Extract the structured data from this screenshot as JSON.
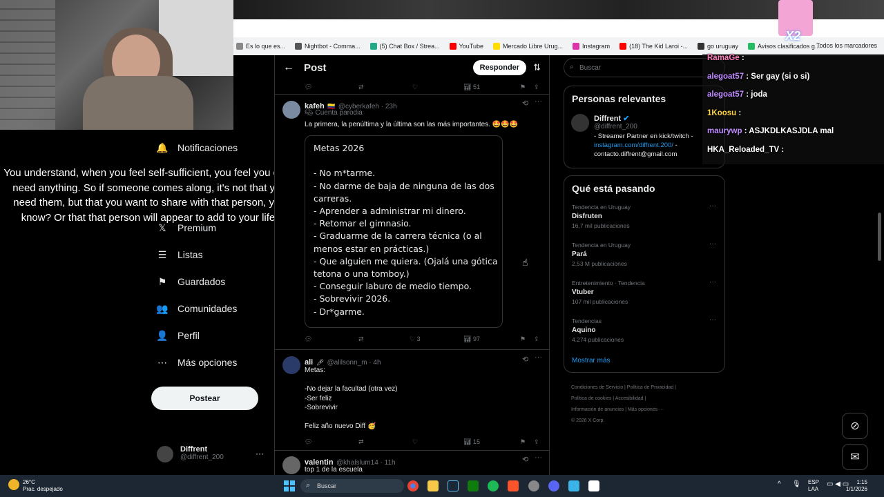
{
  "subtitle": "You understand, when you feel self-sufficient, you feel you don't need anything. So if someone comes along, it's not that you need them, but that you want to share with that person, you know? Or that that person will appear to add to your life.",
  "bookmarks": [
    {
      "label": "Es lo que es...",
      "color": "#888"
    },
    {
      "label": "Nightbot - Comma...",
      "color": "#555"
    },
    {
      "label": "(5) Chat Box / Strea...",
      "color": "#2a8"
    },
    {
      "label": "YouTube",
      "color": "#f00"
    },
    {
      "label": "Mercado Libre Urug...",
      "color": "#fd0"
    },
    {
      "label": "Instagram",
      "color": "#d3a"
    },
    {
      "label": "(18) The Kid Laroi -...",
      "color": "#f00"
    },
    {
      "label": "go uruguay",
      "color": "#333"
    },
    {
      "label": "Avisos clasificados g...",
      "color": "#2b6"
    }
  ],
  "bookmarks_right": "Todos los marcadores",
  "nav": [
    {
      "label": "Notificaciones",
      "icon": "bell-icon",
      "glyph": "🔔"
    },
    {
      "label": "Premium",
      "icon": "x-logo-icon",
      "glyph": "𝕏"
    },
    {
      "label": "Listas",
      "icon": "list-icon",
      "glyph": "☰"
    },
    {
      "label": "Guardados",
      "icon": "bookmark-icon",
      "glyph": "⚑"
    },
    {
      "label": "Comunidades",
      "icon": "communities-icon",
      "glyph": "👥"
    },
    {
      "label": "Perfil",
      "icon": "profile-icon",
      "glyph": "👤"
    },
    {
      "label": "Más opciones",
      "icon": "more-icon",
      "glyph": "⋯"
    }
  ],
  "post_button": "Postear",
  "account": {
    "name": "Diffrent",
    "handle": "@diffrent_200"
  },
  "header": {
    "title": "Post",
    "reply": "Responder"
  },
  "top_actions": {
    "views": "51"
  },
  "tweet1": {
    "name": "kafeh",
    "handle": "@cyberkafeh · 23h",
    "badge": "Cuenta parodia",
    "text": "La primera, la penúltima y la última son las más importantes. 🤩🤩🤩",
    "image_text": "Metas 2026\n\n- No m*tarme.\n- No darme de baja de ninguna de las dos\ncarreras.\n- Aprender a administrar mi dinero.\n- Retomar el gimnasio.\n- Graduarme de la carrera técnica (o al\nmenos estar en prácticas.)\n- Que alguien me quiera. (Ojalá una gótica\ntetona o una tomboy.)\n- Conseguir laburo de medio tiempo.\n- Sobrevivir 2026.\n- Dr*garme.",
    "likes": "3",
    "views": "97"
  },
  "tweet2": {
    "name": "ali",
    "handle": "@alilsonn_m · 4h",
    "lines": [
      "Metas:",
      "",
      "-No dejar la facultad (otra vez)",
      "-Ser feliz",
      "-Sobrevivir",
      "",
      "Feliz año nuevo Diff 🥳"
    ],
    "views": "15"
  },
  "tweet3": {
    "name": "valentin",
    "handle": "@khalslum14 · 11h",
    "text": "top 1 de la escuela"
  },
  "search_placeholder": "Buscar",
  "relevant": {
    "title": "Personas relevantes",
    "name": "Diffrent",
    "handle": "@diffrent_200",
    "bio1": "- Streamer Partner en kick/twitch -",
    "link": "instagram.com/diffrent.200/",
    "bio2": " -",
    "email": "contacto.diffrent@gmail.com"
  },
  "trends": {
    "title": "Qué está pasando",
    "items": [
      {
        "context": "Tendencia en Uruguay",
        "name": "Disfruten",
        "count": "16,7 mil publicaciones"
      },
      {
        "context": "Tendencia en Uruguay",
        "name": "Pará",
        "count": "2,53 M publicaciones"
      },
      {
        "context": "Entretenimiento · Tendencia",
        "name": "Vtuber",
        "count": "107 mil publicaciones"
      },
      {
        "context": "Tendencias",
        "name": "Aquino",
        "count": "4.274 publicaciones"
      }
    ],
    "more": "Mostrar más"
  },
  "footer": {
    "row1": "Condiciones de Servicio  |  Política de Privacidad  |",
    "row2": "Política de cookies  |  Accesibilidad  |",
    "row3": "Información de anuncios  |  Más opciones ···",
    "row4": "© 2026 X Corp."
  },
  "chat": [
    {
      "user": "RamaGe",
      "msg": " :",
      "color": "#ff7fbf"
    },
    {
      "user": "alegoat57",
      "msg": " : Ser gay (si o si)",
      "color": "#c08cff"
    },
    {
      "user": "alegoat57",
      "msg": " : joda",
      "color": "#c08cff"
    },
    {
      "user": "1Koosu",
      "msg": " :",
      "color": "#ffd23f"
    },
    {
      "user": "maurywp",
      "msg": " : ASJKDLKASJDLA mal",
      "color": "#c08cff"
    },
    {
      "user": "HKA_Reloaded_TV",
      "msg": " :",
      "color": "#ffffff"
    }
  ],
  "overlay_badge": "X2",
  "taskbar": {
    "temp": "26°C",
    "weather": "Prac. despejado",
    "search": "Buscar",
    "lang1": "ESP",
    "lang2": "LAA",
    "time": "1:15",
    "date": "1/1/2026"
  }
}
